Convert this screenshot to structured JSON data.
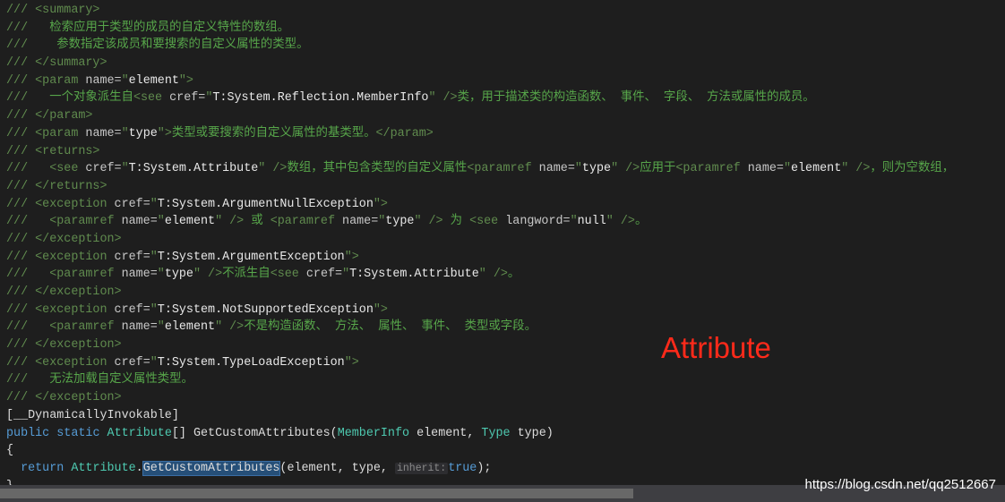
{
  "editor": {
    "lines": [
      [
        [
          "///",
          "d"
        ],
        [
          " <summary>",
          "t"
        ]
      ],
      [
        [
          "///",
          "d"
        ],
        [
          "   检索应用于类型的成员的自定义特性的数组。",
          "c"
        ]
      ],
      [
        [
          "///",
          "d"
        ],
        [
          "    参数指定该成员和要搜索的自定义属性的类型。",
          "c"
        ]
      ],
      [
        [
          "///",
          "d"
        ],
        [
          " </summary>",
          "t"
        ]
      ],
      [
        [
          "///",
          "d"
        ],
        [
          " <param ",
          "t"
        ],
        [
          "name=",
          "a"
        ],
        [
          "\"",
          "t"
        ],
        [
          "element",
          "v"
        ],
        [
          "\">",
          "t"
        ]
      ],
      [
        [
          "///",
          "d"
        ],
        [
          "   一个对象派生自",
          "c"
        ],
        [
          "<see ",
          "t"
        ],
        [
          "cref=",
          "a"
        ],
        [
          "\"",
          "t"
        ],
        [
          "T:System.Reflection.MemberInfo",
          "v"
        ],
        [
          "\" />",
          "t"
        ],
        [
          "类，用于描述类的构造函数、 事件、 字段、 方法或属性的成员。",
          "c"
        ]
      ],
      [
        [
          "///",
          "d"
        ],
        [
          " </param>",
          "t"
        ]
      ],
      [
        [
          "///",
          "d"
        ],
        [
          " <param ",
          "t"
        ],
        [
          "name=",
          "a"
        ],
        [
          "\"",
          "t"
        ],
        [
          "type",
          "v"
        ],
        [
          "\">",
          "t"
        ],
        [
          "类型或要搜索的自定义属性的基类型。",
          "c"
        ],
        [
          "</param>",
          "t"
        ]
      ],
      [
        [
          "///",
          "d"
        ],
        [
          " <returns>",
          "t"
        ]
      ],
      [
        [
          "///",
          "d"
        ],
        [
          "   <see ",
          "t"
        ],
        [
          "cref=",
          "a"
        ],
        [
          "\"",
          "t"
        ],
        [
          "T:System.Attribute",
          "v"
        ],
        [
          "\" />",
          "t"
        ],
        [
          "数组，其中包含类型的自定义属性",
          "c"
        ],
        [
          "<paramref ",
          "t"
        ],
        [
          "name=",
          "a"
        ],
        [
          "\"",
          "t"
        ],
        [
          "type",
          "v"
        ],
        [
          "\" />",
          "t"
        ],
        [
          "应用于",
          "c"
        ],
        [
          "<paramref ",
          "t"
        ],
        [
          "name=",
          "a"
        ],
        [
          "\"",
          "t"
        ],
        [
          "element",
          "v"
        ],
        [
          "\" />",
          "t"
        ],
        [
          "，则为空数组，",
          "c"
        ]
      ],
      [
        [
          "///",
          "d"
        ],
        [
          " </returns>",
          "t"
        ]
      ],
      [
        [
          "///",
          "d"
        ],
        [
          " <exception ",
          "t"
        ],
        [
          "cref=",
          "a"
        ],
        [
          "\"",
          "t"
        ],
        [
          "T:System.ArgumentNullException",
          "v"
        ],
        [
          "\">",
          "t"
        ]
      ],
      [
        [
          "///",
          "d"
        ],
        [
          "   <paramref ",
          "t"
        ],
        [
          "name=",
          "a"
        ],
        [
          "\"",
          "t"
        ],
        [
          "element",
          "v"
        ],
        [
          "\" />",
          "t"
        ],
        [
          " 或 ",
          "c"
        ],
        [
          "<paramref ",
          "t"
        ],
        [
          "name=",
          "a"
        ],
        [
          "\"",
          "t"
        ],
        [
          "type",
          "v"
        ],
        [
          "\" />",
          "t"
        ],
        [
          " 为 ",
          "c"
        ],
        [
          "<see ",
          "t"
        ],
        [
          "langword=",
          "a"
        ],
        [
          "\"",
          "t"
        ],
        [
          "null",
          "v"
        ],
        [
          "\" />",
          "t"
        ],
        [
          "。",
          "c"
        ]
      ],
      [
        [
          "///",
          "d"
        ],
        [
          " </exception>",
          "t"
        ]
      ],
      [
        [
          "///",
          "d"
        ],
        [
          " <exception ",
          "t"
        ],
        [
          "cref=",
          "a"
        ],
        [
          "\"",
          "t"
        ],
        [
          "T:System.ArgumentException",
          "v"
        ],
        [
          "\">",
          "t"
        ]
      ],
      [
        [
          "///",
          "d"
        ],
        [
          "   <paramref ",
          "t"
        ],
        [
          "name=",
          "a"
        ],
        [
          "\"",
          "t"
        ],
        [
          "type",
          "v"
        ],
        [
          "\" />",
          "t"
        ],
        [
          "不派生自",
          "c"
        ],
        [
          "<see ",
          "t"
        ],
        [
          "cref=",
          "a"
        ],
        [
          "\"",
          "t"
        ],
        [
          "T:System.Attribute",
          "v"
        ],
        [
          "\" />",
          "t"
        ],
        [
          "。",
          "c"
        ]
      ],
      [
        [
          "///",
          "d"
        ],
        [
          " </exception>",
          "t"
        ]
      ],
      [
        [
          "///",
          "d"
        ],
        [
          " <exception ",
          "t"
        ],
        [
          "cref=",
          "a"
        ],
        [
          "\"",
          "t"
        ],
        [
          "T:System.NotSupportedException",
          "v"
        ],
        [
          "\">",
          "t"
        ]
      ],
      [
        [
          "///",
          "d"
        ],
        [
          "   <paramref ",
          "t"
        ],
        [
          "name=",
          "a"
        ],
        [
          "\"",
          "t"
        ],
        [
          "element",
          "v"
        ],
        [
          "\" />",
          "t"
        ],
        [
          "不是构造函数、 方法、 属性、 事件、 类型或字段。",
          "c"
        ]
      ],
      [
        [
          "///",
          "d"
        ],
        [
          " </exception>",
          "t"
        ]
      ],
      [
        [
          "///",
          "d"
        ],
        [
          " <exception ",
          "t"
        ],
        [
          "cref=",
          "a"
        ],
        [
          "\"",
          "t"
        ],
        [
          "T:System.TypeLoadException",
          "v"
        ],
        [
          "\">",
          "t"
        ]
      ],
      [
        [
          "///",
          "d"
        ],
        [
          "   无法加载自定义属性类型。",
          "c"
        ]
      ],
      [
        [
          "///",
          "d"
        ],
        [
          " </exception>",
          "t"
        ]
      ],
      [
        [
          "[__DynamicallyInvokable]",
          "p"
        ]
      ],
      [
        [
          "public",
          "k"
        ],
        [
          " ",
          "p"
        ],
        [
          "static",
          "k"
        ],
        [
          " ",
          "p"
        ],
        [
          "Attribute",
          "ty"
        ],
        [
          "[] GetCustomAttributes(",
          "p"
        ],
        [
          "MemberInfo",
          "ty"
        ],
        [
          " element, ",
          "p"
        ],
        [
          "Type",
          "ty"
        ],
        [
          " type)",
          "p"
        ]
      ],
      [
        [
          "{",
          "p"
        ]
      ],
      [
        [
          "  ",
          "p"
        ],
        [
          "return",
          "k"
        ],
        [
          " ",
          "p"
        ],
        [
          "Attribute",
          "ty"
        ],
        [
          ".",
          "p"
        ],
        [
          "GetCustomAttributes",
          "sel"
        ],
        [
          "(element, type, ",
          "p"
        ],
        [
          "inherit:",
          "h"
        ],
        [
          "true",
          "k"
        ],
        [
          ");",
          "p"
        ]
      ],
      [
        [
          "}",
          "p"
        ]
      ]
    ]
  },
  "annotation": "Attribute",
  "watermark": "https://blog.csdn.net/qq2512667",
  "scrollbar": {
    "position_fraction": 0.0,
    "visible_fraction": 0.63
  }
}
